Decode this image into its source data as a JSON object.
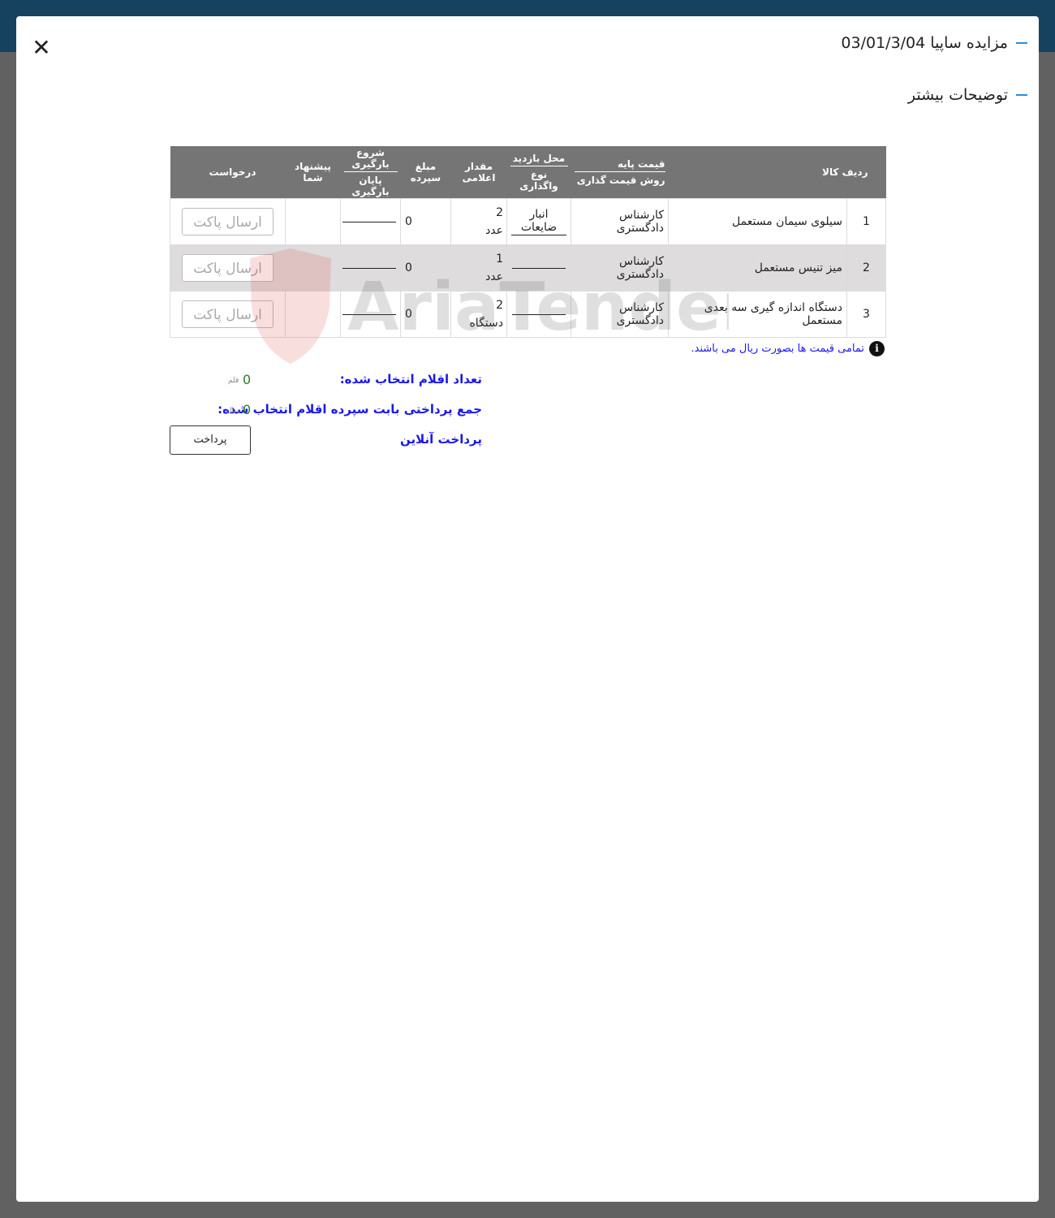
{
  "modal": {
    "title": "مزایده ساپیا 03/01/3/04",
    "subtitle": "توضیحات بیشتر"
  },
  "table": {
    "headers": {
      "row_item": "ردیف کالا",
      "base_price": "قیمت پایه",
      "pricing_method": "روش قیمت گذاری",
      "visit_location": "محل بازدید",
      "assignment_type": "نوع واگذاری",
      "declared_qty": "مقدار اعلامی",
      "deposit": "مبلغ سپرده",
      "load_start": "شروع بارگیری",
      "load_end": "پایان بارگیری",
      "your_offer": "پیشنهاد شما",
      "request": "درخواست"
    },
    "rows": [
      {
        "num": "1",
        "name": "سیلوی سیمان مستعمل",
        "pricing": "کارشناس دادگستری",
        "location": "انبار ضایعات",
        "qty": "2",
        "unit": "عدد",
        "deposit": "0",
        "action": "ارسال پاکت"
      },
      {
        "num": "2",
        "name": "میز تنیس مستعمل",
        "pricing": "کارشناس دادگستری",
        "location": "",
        "qty": "1",
        "unit": "عدد",
        "deposit": "0",
        "action": "ارسال پاکت"
      },
      {
        "num": "3",
        "name": "دستگاه اندازه گیری سه بعدی مستعمل",
        "pricing": "کارشناس دادگستری",
        "location": "",
        "qty": "2",
        "unit": "دستگاه",
        "deposit": "0",
        "action": "ارسال پاکت"
      }
    ]
  },
  "watermark_text": "AriaTender.neT",
  "note": "تمامی قیمت ها بصورت ریال می باشند.",
  "summary": {
    "selected_label": "تعداد اقلام انتخاب شده:",
    "selected_value": "0",
    "selected_unit": "قلم",
    "total_label": "جمع پرداختی بابت سپرده اقلام انتخاب شده:",
    "total_value": "0",
    "total_unit": "ریال",
    "online_label": "پرداخت آنلاین",
    "pay_button": "پرداخت"
  },
  "colors": {
    "header_bg": "#757575",
    "accent_blue": "#1a1ae8",
    "dash": "#2a8fd8",
    "topbar": "#17425f"
  }
}
